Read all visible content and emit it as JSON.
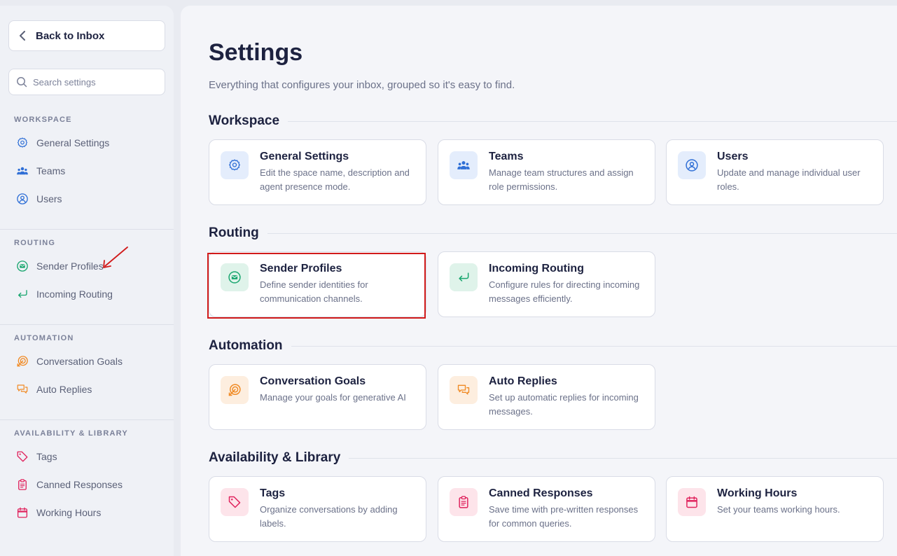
{
  "sidebar": {
    "back_label": "Back to Inbox",
    "search_placeholder": "Search settings",
    "groups": [
      {
        "label": "WORKSPACE",
        "items": [
          {
            "label": "General Settings",
            "icon": "gear-icon"
          },
          {
            "label": "Teams",
            "icon": "team-icon"
          },
          {
            "label": "Users",
            "icon": "user-icon"
          }
        ]
      },
      {
        "label": "ROUTING",
        "items": [
          {
            "label": "Sender Profiles",
            "icon": "mail-badge-icon"
          },
          {
            "label": "Incoming Routing",
            "icon": "return-arrow-icon"
          }
        ]
      },
      {
        "label": "AUTOMATION",
        "items": [
          {
            "label": "Conversation Goals",
            "icon": "target-icon"
          },
          {
            "label": "Auto Replies",
            "icon": "chat-bubbles-icon"
          }
        ]
      },
      {
        "label": "AVAILABILITY & LIBRARY",
        "items": [
          {
            "label": "Tags",
            "icon": "tag-icon"
          },
          {
            "label": "Canned Responses",
            "icon": "clipboard-icon"
          },
          {
            "label": "Working Hours",
            "icon": "calendar-icon"
          }
        ]
      }
    ]
  },
  "main": {
    "title": "Settings",
    "subtitle": "Everything that configures your inbox, grouped so it's easy to find.",
    "sections": [
      {
        "title": "Workspace",
        "cards": [
          {
            "title": "General Settings",
            "desc": "Edit the space name, description and agent presence mode."
          },
          {
            "title": "Teams",
            "desc": "Manage team structures and assign role permissions."
          },
          {
            "title": "Users",
            "desc": "Update and manage individual user roles."
          }
        ]
      },
      {
        "title": "Routing",
        "cards": [
          {
            "title": "Sender Profiles",
            "desc": "Define sender identities for communication channels."
          },
          {
            "title": "Incoming Routing",
            "desc": "Configure rules for directing incoming messages efficiently."
          }
        ]
      },
      {
        "title": "Automation",
        "cards": [
          {
            "title": "Conversation Goals",
            "desc": "Manage your goals for generative AI"
          },
          {
            "title": "Auto Replies",
            "desc": "Set up automatic replies for incoming messages."
          }
        ]
      },
      {
        "title": "Availability & Library",
        "cards": [
          {
            "title": "Tags",
            "desc": "Organize conversations by adding labels."
          },
          {
            "title": "Canned Responses",
            "desc": "Save time with pre-written responses for common queries."
          },
          {
            "title": "Working Hours",
            "desc": "Set your teams working hours."
          }
        ]
      }
    ]
  },
  "colors": {
    "workspace": "#2f6fd6",
    "routing": "#19a66f",
    "automation": "#f08a24",
    "library": "#e0245e",
    "highlight": "#d11a1a",
    "annotation_arrow": "#d11a1a"
  }
}
